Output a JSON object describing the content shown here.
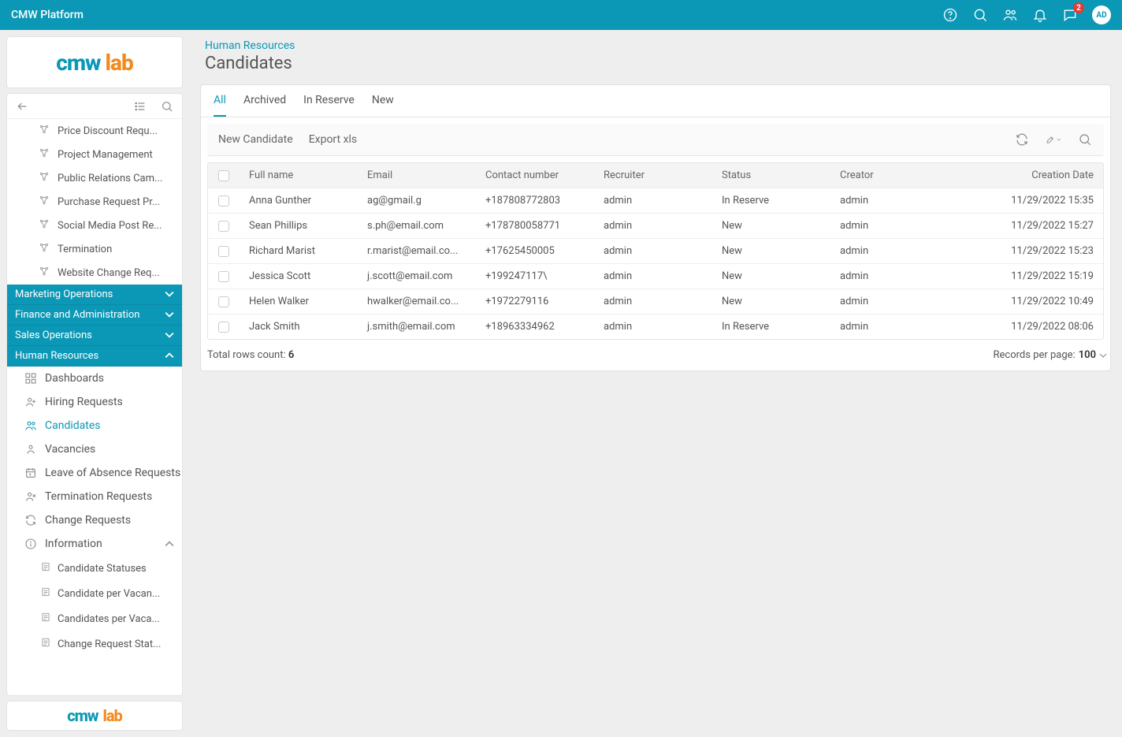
{
  "topbar": {
    "title": "CMW Platform",
    "notif_badge": "2",
    "avatar": "AD"
  },
  "logo": {
    "part1": "cmw",
    "part2": "lab"
  },
  "tree_upper": [
    "Price Discount Requ...",
    "Project Management",
    "Public Relations Cam...",
    "Purchase Request Pr...",
    "Social Media Post Re...",
    "Termination",
    "Website Change Req..."
  ],
  "sections": [
    "Marketing Operations",
    "Finance and Administration",
    "Sales Operations",
    "Human Resources"
  ],
  "hr_items": [
    "Dashboards",
    "Hiring Requests",
    "Candidates",
    "Vacancies",
    "Leave of Absence Requests",
    "Termination Requests",
    "Change Requests",
    "Information"
  ],
  "hr_active_index": 2,
  "info_sub": [
    "Candidate Statuses",
    "Candidate per Vacan...",
    "Candidates per Vaca...",
    "Change Request Stat..."
  ],
  "crumb": {
    "parent": "Human Resources",
    "title": "Candidates"
  },
  "tabs": [
    "All",
    "Archived",
    "In Reserve",
    "New"
  ],
  "tab_active_index": 0,
  "toolbar": {
    "new": "New Candidate",
    "export": "Export xls"
  },
  "columns": [
    "Full name",
    "Email",
    "Contact number",
    "Recruiter",
    "Status",
    "Creator",
    "Creation Date"
  ],
  "rows": [
    {
      "name": "Anna Gunther",
      "email": "ag@gmail.g",
      "phone": "+187808772803",
      "recruiter": "admin",
      "status": "In Reserve",
      "creator": "admin",
      "date": "11/29/2022 15:35"
    },
    {
      "name": "Sean Phillips",
      "email": "s.ph@email.com",
      "phone": "+178780058771",
      "recruiter": "admin",
      "status": "New",
      "creator": "admin",
      "date": "11/29/2022 15:27"
    },
    {
      "name": "Richard Marist",
      "email": "r.marist@email.co...",
      "phone": "+17625450005",
      "recruiter": "admin",
      "status": "New",
      "creator": "admin",
      "date": "11/29/2022 15:23"
    },
    {
      "name": "Jessica Scott",
      "email": "j.scott@email.com",
      "phone": "+199247117\\",
      "recruiter": "admin",
      "status": "New",
      "creator": "admin",
      "date": "11/29/2022 15:19"
    },
    {
      "name": "Helen Walker",
      "email": "hwalker@email.co...",
      "phone": "+1972279116",
      "recruiter": "admin",
      "status": "New",
      "creator": "admin",
      "date": "11/29/2022 10:49"
    },
    {
      "name": "Jack Smith",
      "email": "j.smith@email.com",
      "phone": "+18963334962",
      "recruiter": "admin",
      "status": "In Reserve",
      "creator": "admin",
      "date": "11/29/2022 08:06"
    }
  ],
  "footer": {
    "total_label": "Total rows count:",
    "total_value": "6",
    "per_page_label": "Records per page:",
    "per_page_value": "100"
  }
}
